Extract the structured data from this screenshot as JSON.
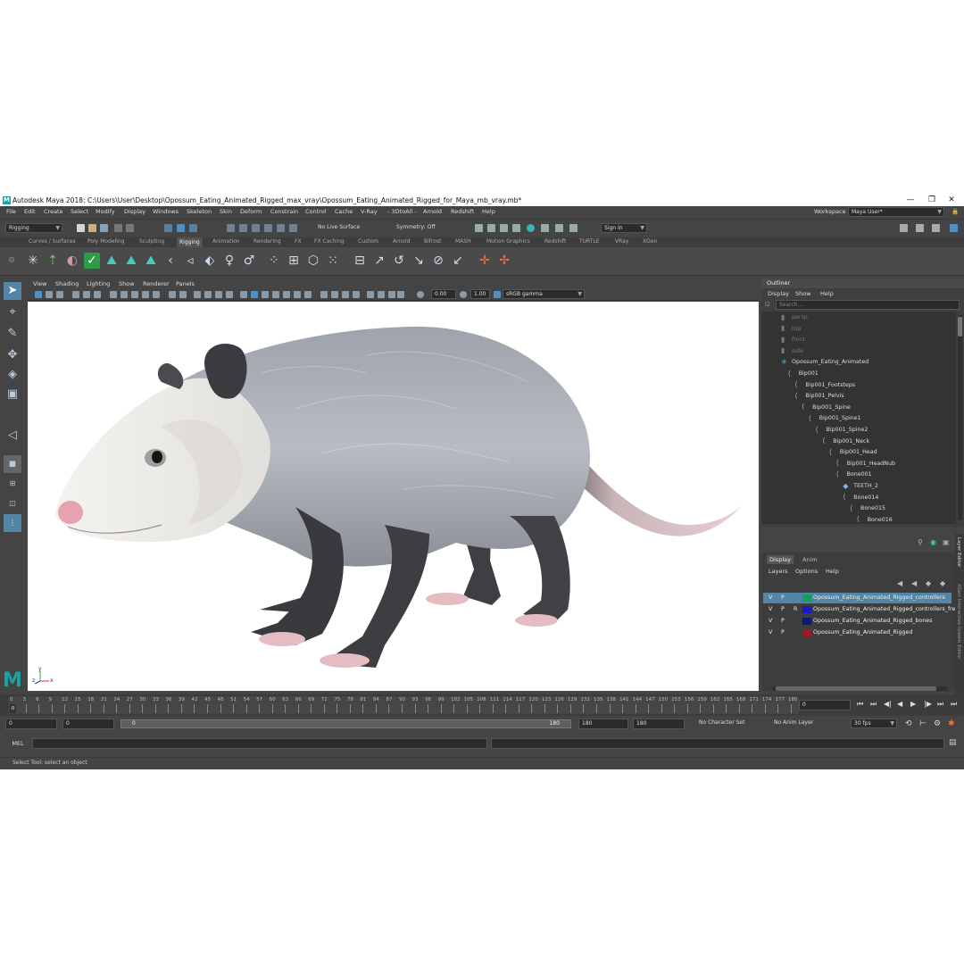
{
  "window": {
    "app_letter": "M",
    "title": "Autodesk Maya 2018: C:\\Users\\User\\Desktop\\Opossum_Eating_Animated_Rigged_max_vray\\Opossum_Eating_Animated_Rigged_for_Maya_mb_vray.mb*",
    "minimize": "—",
    "maximize": "❐",
    "close": "✕"
  },
  "menubar": {
    "items": [
      "File",
      "Edit",
      "Create",
      "Select",
      "Modify",
      "Display",
      "Windows",
      "Skeleton",
      "Skin",
      "Deform",
      "Constrain",
      "Control",
      "Cache",
      "V-Ray",
      "- 3DtoAll -",
      "Arnold",
      "Redshift",
      "Help"
    ],
    "workspace_label": "Workspace :",
    "workspace_value": "Maya User*"
  },
  "statusline": {
    "menu_set": "Rigging",
    "live_surface": "No Live Surface",
    "symmetry": "Symmetry: Off",
    "sign_in": "Sign In"
  },
  "shelf_tabs": [
    "Curves / Surfaces",
    "Poly Modeling",
    "Sculpting",
    "Rigging",
    "Animation",
    "Rendering",
    "FX",
    "FX Caching",
    "Custom",
    "Arnold",
    "Bifrost",
    "MASH",
    "Motion Graphics",
    "Redshift",
    "TURTLE",
    "VRay",
    "XGen"
  ],
  "shelf_active": "Rigging",
  "viewport": {
    "menus": [
      "View",
      "Shading",
      "Lighting",
      "Show",
      "Renderer",
      "Panels"
    ],
    "exposure": "0.00",
    "gamma": "1.00",
    "color_space": "sRGB gamma",
    "axis_z": "z",
    "axis_x": "x",
    "axis_y": "y"
  },
  "outliner": {
    "title": "Outliner",
    "menus": [
      "Display",
      "Show",
      "Help"
    ],
    "search_placeholder": "Search...",
    "items": [
      {
        "label": "persp",
        "depth": 0,
        "dim": true,
        "icon": "camera-icon"
      },
      {
        "label": "top",
        "depth": 0,
        "dim": true,
        "icon": "camera-icon"
      },
      {
        "label": "front",
        "depth": 0,
        "dim": true,
        "icon": "camera-icon"
      },
      {
        "label": "side",
        "depth": 0,
        "dim": true,
        "icon": "camera-icon"
      },
      {
        "label": "Opossum_Eating_Animated",
        "depth": 0,
        "dim": false,
        "icon": "group-icon"
      },
      {
        "label": "Bip001",
        "depth": 1,
        "dim": false,
        "icon": "joint-icon"
      },
      {
        "label": "Bip001_Footsteps",
        "depth": 2,
        "dim": false,
        "icon": "joint-icon"
      },
      {
        "label": "Bip001_Pelvis",
        "depth": 2,
        "dim": false,
        "icon": "joint-icon"
      },
      {
        "label": "Bip001_Spine",
        "depth": 3,
        "dim": false,
        "icon": "joint-icon"
      },
      {
        "label": "Bip001_Spine1",
        "depth": 4,
        "dim": false,
        "icon": "joint-icon"
      },
      {
        "label": "Bip001_Spine2",
        "depth": 5,
        "dim": false,
        "icon": "joint-icon"
      },
      {
        "label": "Bip001_Neck",
        "depth": 6,
        "dim": false,
        "icon": "joint-icon"
      },
      {
        "label": "Bip001_Head",
        "depth": 7,
        "dim": false,
        "icon": "joint-icon"
      },
      {
        "label": "Bip001_HeadNub",
        "depth": 8,
        "dim": false,
        "icon": "joint-icon"
      },
      {
        "label": "Bone001",
        "depth": 8,
        "dim": false,
        "icon": "joint-icon"
      },
      {
        "label": "TEETH_2",
        "depth": 9,
        "dim": false,
        "icon": "mesh-icon"
      },
      {
        "label": "Bone014",
        "depth": 9,
        "dim": false,
        "icon": "joint-icon"
      },
      {
        "label": "Bone015",
        "depth": 10,
        "dim": false,
        "icon": "joint-icon"
      },
      {
        "label": "Bone016",
        "depth": 11,
        "dim": false,
        "icon": "joint-icon"
      }
    ]
  },
  "layers": {
    "tabs": [
      "Display",
      "Anim"
    ],
    "menus": [
      "Layers",
      "Options",
      "Help"
    ],
    "rows": [
      {
        "v": "V",
        "p": "P",
        "r": "",
        "color": "#14a05a",
        "name": "Opossum_Eating_Animated_Rigged_controllers",
        "selected": true
      },
      {
        "v": "V",
        "p": "P",
        "r": "R",
        "color": "#1a18c8",
        "name": "Opossum_Eating_Animated_Rigged_controllers_free",
        "selected": false
      },
      {
        "v": "V",
        "p": "P",
        "r": "",
        "color": "#0d1a6e",
        "name": "Opossum_Eating_Animated_Rigged_bones",
        "selected": false
      },
      {
        "v": "V",
        "p": "P",
        "r": "",
        "color": "#a01826",
        "name": "Opossum_Eating_Animated_Rigged",
        "selected": false
      }
    ],
    "side_labels": [
      "Layer Editor",
      "XGen Interactive Groom Editor"
    ]
  },
  "timeline": {
    "ticks": [
      "0",
      "3",
      "6",
      "9",
      "12",
      "15",
      "18",
      "21",
      "24",
      "27",
      "30",
      "33",
      "36",
      "39",
      "42",
      "45",
      "48",
      "51",
      "54",
      "57",
      "60",
      "63",
      "66",
      "69",
      "72",
      "75",
      "78",
      "81",
      "84",
      "87",
      "90",
      "93",
      "96",
      "99",
      "102",
      "105",
      "108",
      "111",
      "114",
      "117",
      "120",
      "123",
      "126",
      "129",
      "132",
      "135",
      "138",
      "141",
      "144",
      "147",
      "150",
      "153",
      "156",
      "159",
      "162",
      "165",
      "168",
      "171",
      "174",
      "177",
      "180"
    ],
    "current_frame": "0",
    "current_frame_field": "0"
  },
  "range": {
    "start": "0",
    "anim_start": "0",
    "slider_start": "0",
    "slider_end": "180",
    "anim_end": "180",
    "end": "180",
    "character_set": "No Character Set",
    "anim_layer": "No Anim Layer",
    "fps": "30 fps"
  },
  "command_line": {
    "label": "MEL"
  },
  "help_line": "Select Tool: select an object"
}
